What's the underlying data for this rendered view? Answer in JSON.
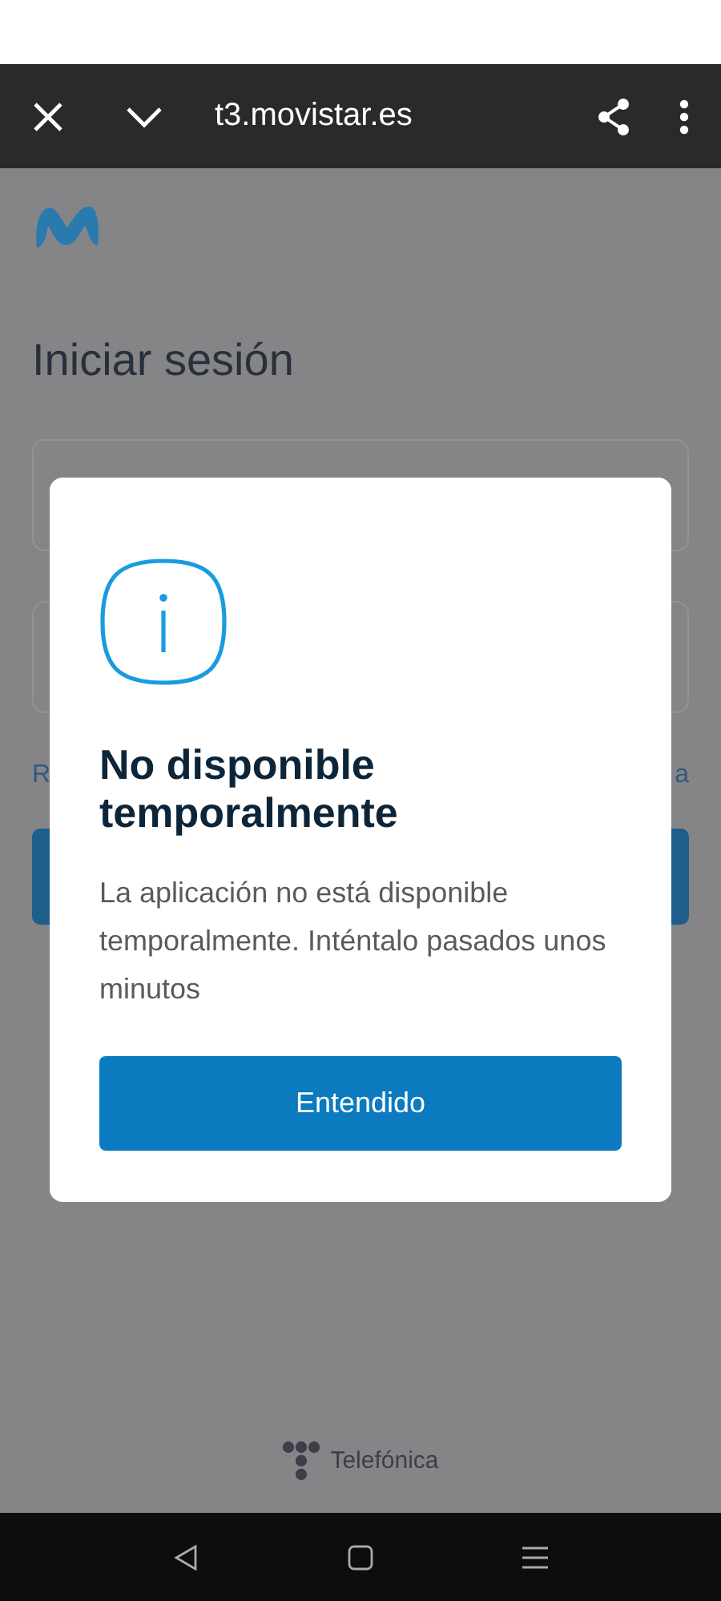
{
  "browser_bar": {
    "url": "t3.movistar.es"
  },
  "page": {
    "title": "Iniciar sesión",
    "link_left": "R",
    "link_right": "a"
  },
  "dialog": {
    "title": "No disponible temporalmente",
    "message": "La aplicación no está disponible temporalmente. Inténtalo pasados unos minutos",
    "button": "Entendido"
  },
  "footer": {
    "brand": "Telefónica"
  }
}
